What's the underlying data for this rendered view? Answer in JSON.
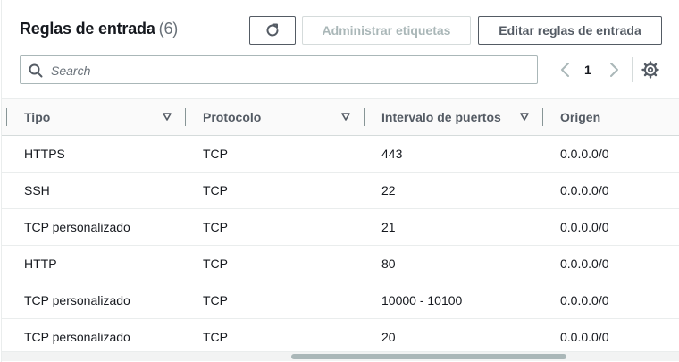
{
  "header": {
    "title": "Reglas de entrada",
    "count": "(6)",
    "refresh_icon": "refresh-icon",
    "tags_button": "Administrar etiquetas",
    "edit_button": "Editar reglas de entrada"
  },
  "search": {
    "placeholder": "Search",
    "icon": "search-icon"
  },
  "pagination": {
    "current_page": "1",
    "prev_icon": "chevron-left-icon",
    "next_icon": "chevron-right-icon",
    "settings_icon": "gear-icon"
  },
  "table": {
    "columns": [
      {
        "label": "Tipo"
      },
      {
        "label": "Protocolo"
      },
      {
        "label": "Intervalo de puertos"
      },
      {
        "label": "Origen"
      }
    ],
    "rows": [
      {
        "tipo": "HTTPS",
        "protocolo": "TCP",
        "puertos": "443",
        "origen": "0.0.0.0/0"
      },
      {
        "tipo": "SSH",
        "protocolo": "TCP",
        "puertos": "22",
        "origen": "0.0.0.0/0"
      },
      {
        "tipo": "TCP personalizado",
        "protocolo": "TCP",
        "puertos": "21",
        "origen": "0.0.0.0/0"
      },
      {
        "tipo": "HTTP",
        "protocolo": "TCP",
        "puertos": "80",
        "origen": "0.0.0.0/0"
      },
      {
        "tipo": "TCP personalizado",
        "protocolo": "TCP",
        "puertos": "10000 - 10100",
        "origen": "0.0.0.0/0"
      },
      {
        "tipo": "TCP personalizado",
        "protocolo": "TCP",
        "puertos": "20",
        "origen": "0.0.0.0/0"
      }
    ]
  },
  "colors": {
    "text": "#16191f",
    "muted": "#687078",
    "border": "#aab7b8",
    "disabled": "#aab7b8"
  }
}
